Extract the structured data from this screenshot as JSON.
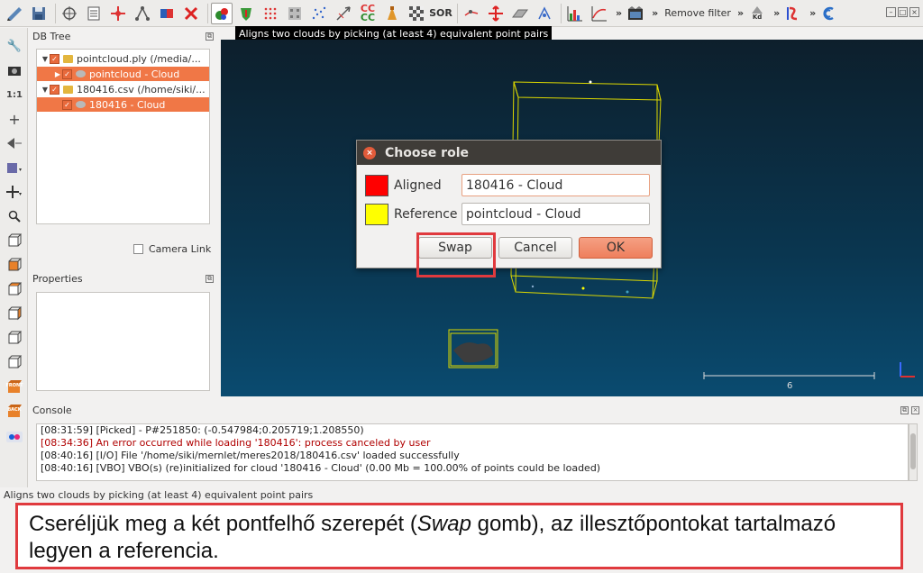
{
  "toolbar": {
    "remove_filter_label": "Remove filter",
    "chevron": "»",
    "icons": [
      "open-icon",
      "save-icon",
      "global-shift-icon",
      "properties-list-icon",
      "clone-icon",
      "merge-icon",
      "segment-icon",
      "delete-icon",
      "point-pair-align-icon",
      "fine-registration-icon",
      "sample-points-icon",
      "subsample-icon",
      "noise-filter-icon",
      "compute-normals-icon",
      "cloud-cloud-dist-icon",
      "cloud-mesh-dist-icon",
      "octree-icon",
      "checkerboard-icon",
      "sor-filter-icon",
      "pick-icon",
      "translate-rotate-icon",
      "plane-icon",
      "height-icon",
      "histogram-icon",
      "scalar-curve-icon",
      "animation-icon",
      "kd-icon",
      "scalar-field-icon",
      "app-icon"
    ],
    "cc_label": "CC",
    "sor_label": "SOR",
    "kd_label": "Kd"
  },
  "tooltip": "Aligns two clouds by picking (at least 4) equivalent point pairs",
  "left_toolbar": {
    "one_to_one_label": "1:1",
    "front_label": "FRONT",
    "back_label": "BACK"
  },
  "db_tree": {
    "title": "DB Tree",
    "items": [
      {
        "label": "pointcloud.ply (/media/...",
        "level": 0,
        "selected": false,
        "type": "file"
      },
      {
        "label": "pointcloud - Cloud",
        "level": 1,
        "selected": true,
        "type": "cloud"
      },
      {
        "label": "180416.csv (/home/siki/...",
        "level": 0,
        "selected": false,
        "type": "file"
      },
      {
        "label": "180416 - Cloud",
        "level": 1,
        "selected": true,
        "type": "cloud"
      }
    ]
  },
  "camera_link_label": "Camera Link",
  "properties_title": "Properties",
  "view3d": {
    "scale_label": "6"
  },
  "dialog": {
    "title": "Choose role",
    "aligned": {
      "label": "Aligned",
      "value": "180416 - Cloud",
      "color": "#ff0000"
    },
    "reference": {
      "label": "Reference",
      "value": "pointcloud - Cloud",
      "color": "#ffff00"
    },
    "swap_label": "Swap",
    "cancel_label": "Cancel",
    "ok_label": "OK"
  },
  "console": {
    "title": "Console",
    "lines": [
      {
        "text": "[08:31:59] [Picked]        - P#251850: (-0.547984;0.205719;1.208550)",
        "error": false
      },
      {
        "text": "[08:34:36] An error occurred while loading '180416': process canceled by user",
        "error": true
      },
      {
        "text": "[08:40:16] [I/O] File '/home/siki/mernlet/meres2018/180416.csv' loaded successfully",
        "error": false
      },
      {
        "text": "[08:40:16] [VBO] VBO(s) (re)initialized for cloud '180416 - Cloud' (0.00 Mb = 100.00% of points could be loaded)",
        "error": false
      }
    ]
  },
  "status_bar": "Aligns two clouds by picking (at least 4) equivalent point pairs",
  "caption": {
    "before": "Cseréljük meg a két pontfelhő szerepét (",
    "emphasis": "Swap",
    "after": " gomb), az illesztőpontokat tartalmazó legyen a referencia."
  },
  "colors": {
    "accent": "#f07746",
    "highlight_box": "#e03a3e",
    "bbox_yellow": "#e6e000"
  }
}
